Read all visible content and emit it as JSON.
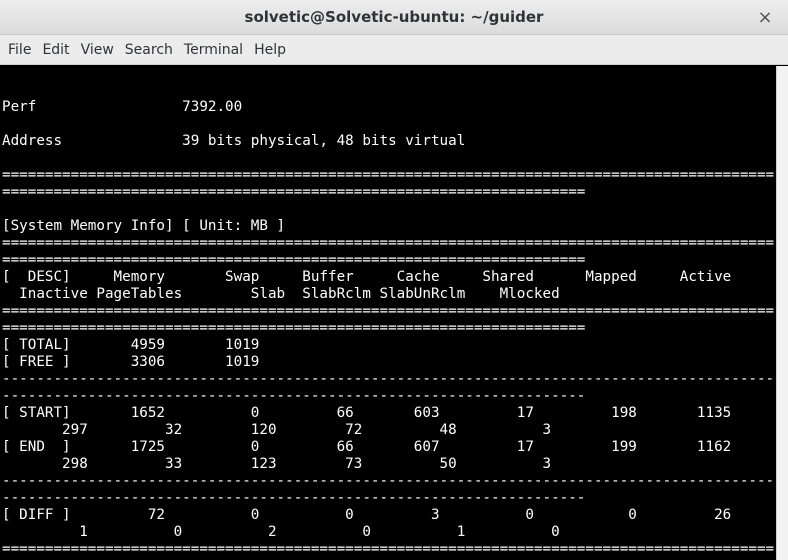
{
  "window": {
    "title": "solvetic@Solvetic-ubuntu: ~/guider",
    "close_glyph": "×"
  },
  "menu": {
    "items": [
      "File",
      "Edit",
      "View",
      "Search",
      "Terminal",
      "Help"
    ]
  },
  "terminal": {
    "lines": [
      "",
      "Perf                 7392.00",
      "",
      "Address              39 bits physical, 48 bits virtual",
      "",
      "==========================================================================================",
      "====================================================================",
      "",
      "[System Memory Info] [ Unit: MB ]",
      "==========================================================================================",
      "====================================================================",
      "[  DESC]     Memory       Swap     Buffer     Cache     Shared      Mapped     Active",
      "  Inactive PageTables        Slab  SlabRclm SlabUnRclm    Mlocked",
      "==========================================================================================",
      "====================================================================",
      "[ TOTAL]       4959       1019",
      "[ FREE ]       3306       1019",
      "------------------------------------------------------------------------------------------",
      "--------------------------------------------------------------------",
      "[ START]       1652          0         66       603         17         198       1135",
      "       297         32        120        72         48          3",
      "[ END  ]       1725          0         66       607         17         199       1162",
      "       298         33        123        73         50          3",
      "------------------------------------------------------------------------------------------",
      "--------------------------------------------------------------------",
      "[ DIFF ]         72          0          0         3          0           0         26",
      "         1          0          2          0          1          0",
      "==========================================================================================",
      ":"
    ]
  }
}
